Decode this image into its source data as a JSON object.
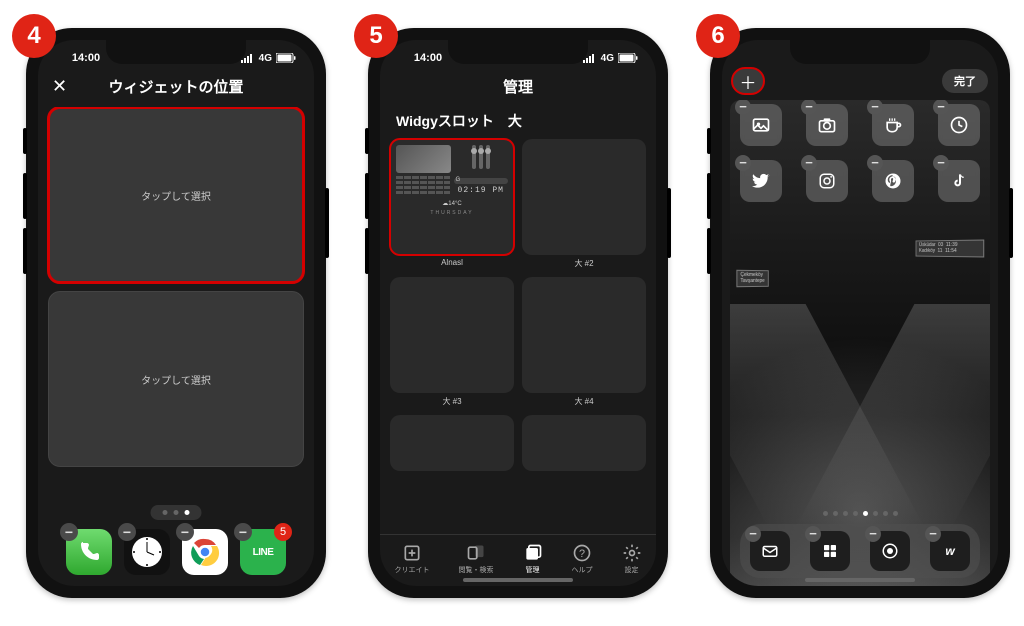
{
  "badges": [
    "4",
    "5",
    "6"
  ],
  "status": {
    "time": "14:00",
    "net": "4G"
  },
  "screen4": {
    "title": "ウィジェットの位置",
    "slot_label": "タップして選択",
    "dock_notification": "5"
  },
  "screen5": {
    "title": "管理",
    "section": "Widgyスロット　大",
    "tiles": [
      {
        "label": "Alnasl",
        "clock": "02:19 PM",
        "temp": "☁14°C",
        "day": "THURSDAY"
      },
      {
        "label": "大 #2"
      },
      {
        "label": "大 #3"
      },
      {
        "label": "大 #4"
      }
    ],
    "tabs": [
      {
        "label": "クリエイト"
      },
      {
        "label": "閲覧・検索"
      },
      {
        "label": "管理"
      },
      {
        "label": "ヘルプ"
      },
      {
        "label": "設定"
      }
    ]
  },
  "screen6": {
    "done": "完了",
    "sign1": "Çekmeköy",
    "sign1b": "Tavşantepe",
    "sign2": "Üsküdar  03  11:39\nKadıköy  11  11:54"
  }
}
